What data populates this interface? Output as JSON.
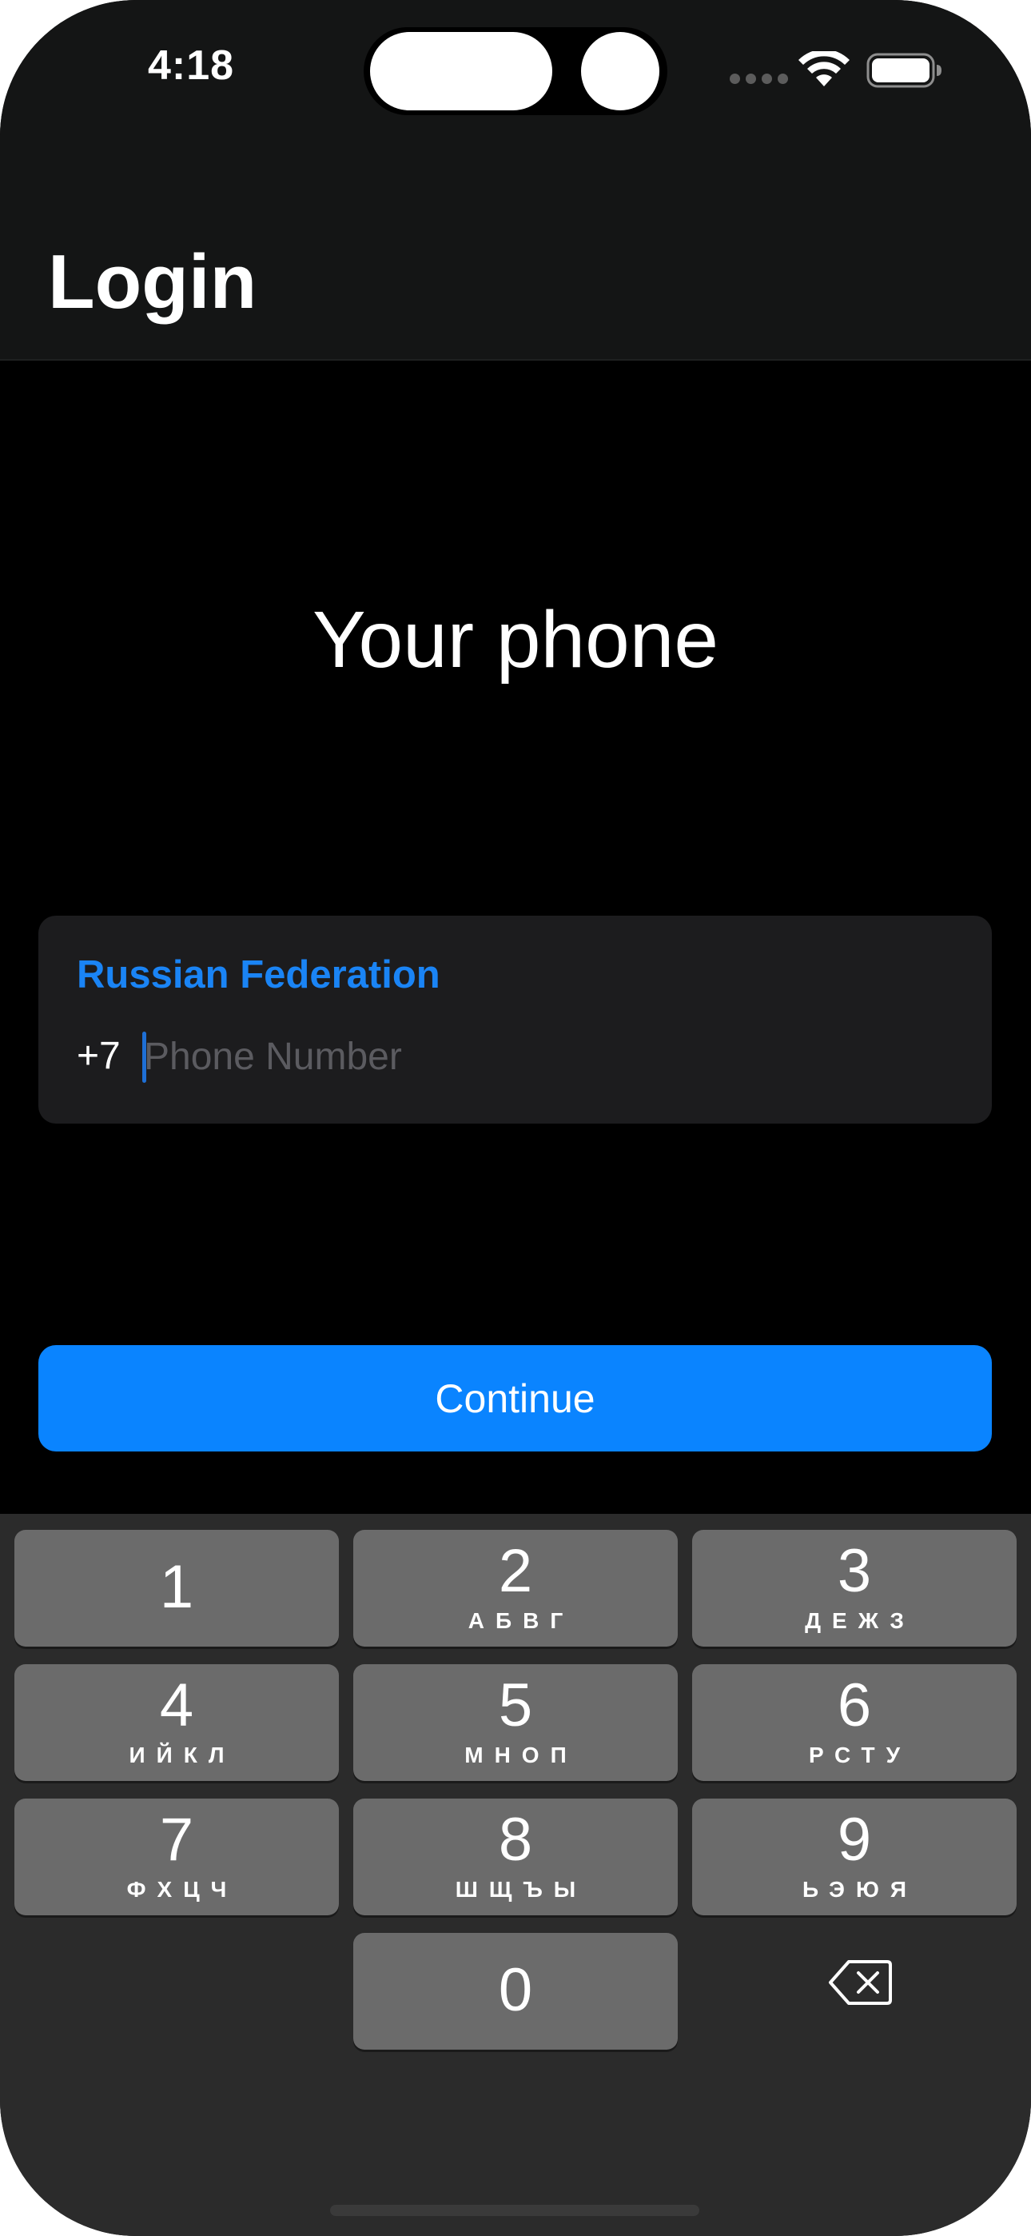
{
  "status_bar": {
    "time": "4:18",
    "icons": [
      "signal-dots-icon",
      "wifi-icon",
      "battery-icon"
    ]
  },
  "nav": {
    "title": "Login"
  },
  "main": {
    "heading": "Your phone",
    "country": "Russian Federation",
    "country_code": "+7",
    "phone_placeholder": "Phone Number",
    "phone_value": "",
    "continue_label": "Continue"
  },
  "keypad": {
    "keys": [
      {
        "num": "1",
        "letters": ""
      },
      {
        "num": "2",
        "letters": "АБВГ"
      },
      {
        "num": "3",
        "letters": "ДЕЖЗ"
      },
      {
        "num": "4",
        "letters": "ИЙКЛ"
      },
      {
        "num": "5",
        "letters": "МНОП"
      },
      {
        "num": "6",
        "letters": "РСТУ"
      },
      {
        "num": "7",
        "letters": "ФХЦЧ"
      },
      {
        "num": "8",
        "letters": "ШЩЪЫ"
      },
      {
        "num": "9",
        "letters": "ЬЭЮЯ"
      },
      {
        "num": "0",
        "letters": ""
      }
    ],
    "delete_icon": "backspace-icon"
  },
  "colors": {
    "accent": "#0a84ff",
    "country_text": "#1a84f5",
    "background": "#000000",
    "nav_background": "#141515",
    "card_background": "#1c1c1e",
    "key_background": "#6b6b6b",
    "keyboard_background": "#2b2b2b"
  }
}
